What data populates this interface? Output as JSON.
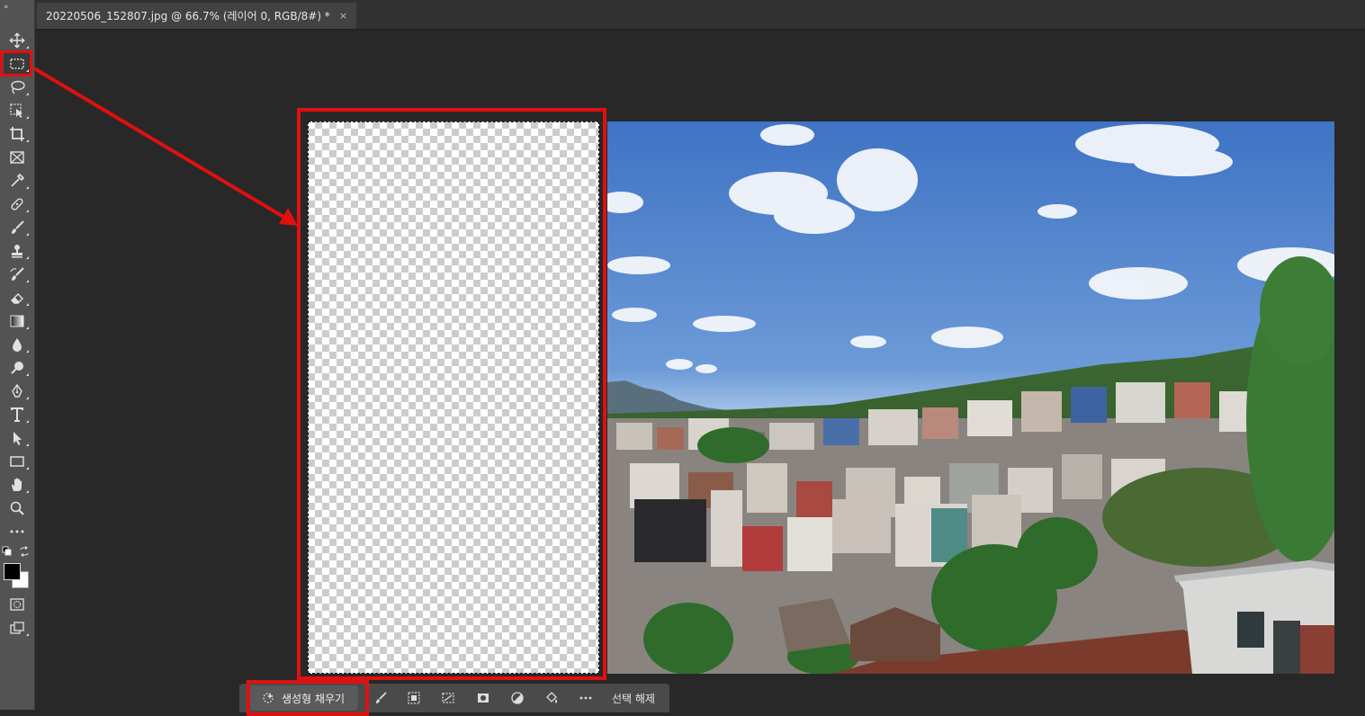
{
  "document_tab": {
    "title": "20220506_152807.jpg @ 66.7% (레이어 0, RGB/8#) *",
    "close_symbol": "×"
  },
  "toolbar": {
    "grip_label": "»",
    "tools": [
      {
        "name": "move-tool",
        "icon": "move-icon"
      },
      {
        "name": "rectangular-marquee-tool",
        "icon": "marquee-icon",
        "active": true
      },
      {
        "name": "lasso-tool",
        "icon": "lasso-icon"
      },
      {
        "name": "object-selection-tool",
        "icon": "object-select-icon"
      },
      {
        "name": "crop-tool",
        "icon": "crop-icon"
      },
      {
        "name": "frame-tool",
        "icon": "frame-icon"
      },
      {
        "name": "eyedropper-tool",
        "icon": "eyedropper-icon"
      },
      {
        "name": "healing-brush-tool",
        "icon": "bandage-icon"
      },
      {
        "name": "brush-tool",
        "icon": "brush-icon"
      },
      {
        "name": "clone-stamp-tool",
        "icon": "stamp-icon"
      },
      {
        "name": "history-brush-tool",
        "icon": "history-brush-icon"
      },
      {
        "name": "eraser-tool",
        "icon": "eraser-icon"
      },
      {
        "name": "gradient-tool",
        "icon": "gradient-icon"
      },
      {
        "name": "blur-tool",
        "icon": "drop-icon"
      },
      {
        "name": "dodge-tool",
        "icon": "dodge-icon"
      },
      {
        "name": "pen-tool",
        "icon": "pen-icon"
      },
      {
        "name": "type-tool",
        "icon": "type-icon"
      },
      {
        "name": "path-selection-tool",
        "icon": "arrow-select-icon"
      },
      {
        "name": "rectangle-tool",
        "icon": "rectangle-icon"
      },
      {
        "name": "hand-tool",
        "icon": "hand-icon"
      },
      {
        "name": "zoom-tool",
        "icon": "zoom-icon"
      },
      {
        "name": "more-tools",
        "icon": "ellipsis-icon"
      }
    ],
    "foreground_color": "#000000",
    "background_color": "#ffffff"
  },
  "contextual_taskbar": {
    "generative_fill_label": "생성형 채우기",
    "deselect_label": "선택 해제",
    "icons": [
      "modify-selection-icon",
      "select-subject-icon",
      "transform-selection-icon",
      "mask-icon",
      "adjustment-icon",
      "fill-icon",
      "more-icon"
    ]
  },
  "colors": {
    "annotation_red": "#e01010",
    "toolbar_bg": "#535353",
    "workspace_bg": "#282828"
  }
}
